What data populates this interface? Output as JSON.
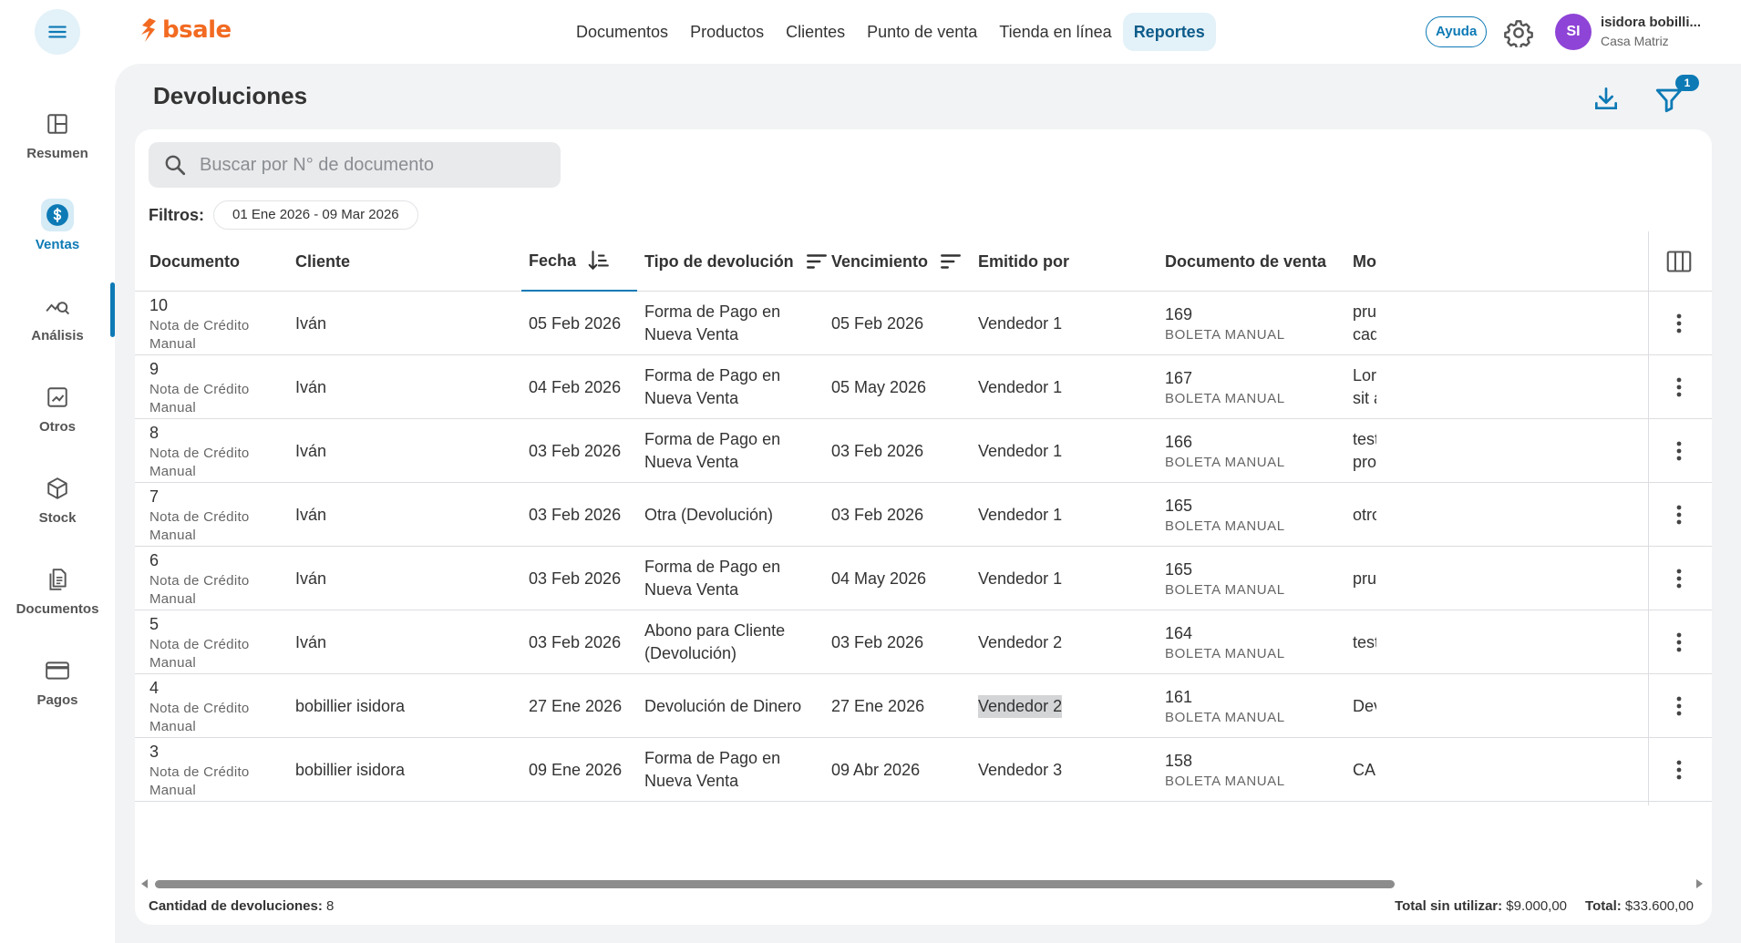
{
  "header": {
    "logo_text": "bsale",
    "nav": [
      "Documentos",
      "Productos",
      "Clientes",
      "Punto de venta",
      "Tienda en línea",
      "Reportes"
    ],
    "active_nav": "Reportes",
    "help_label": "Ayuda",
    "user": {
      "initials": "SI",
      "name": "isidora bobilli...",
      "branch": "Casa Matriz",
      "avatar_color": "#8e44d6"
    }
  },
  "sidebar": {
    "items": [
      {
        "label": "Resumen",
        "icon": "layout-icon"
      },
      {
        "label": "Ventas",
        "icon": "dollar-icon",
        "active": true
      },
      {
        "label": "Análisis",
        "icon": "analytics-icon"
      },
      {
        "label": "Otros",
        "icon": "chart-icon"
      },
      {
        "label": "Stock",
        "icon": "box-icon"
      },
      {
        "label": "Documentos",
        "icon": "documents-icon"
      },
      {
        "label": "Pagos",
        "icon": "card-icon"
      }
    ]
  },
  "page": {
    "title": "Devoluciones",
    "filter_badge": "1",
    "search_placeholder": "Buscar por N° de documento",
    "filters_label": "Filtros:",
    "filter_chip": "01 Ene 2026 - 09 Mar 2026"
  },
  "table": {
    "columns": [
      "Documento",
      "Cliente",
      "Fecha",
      "Tipo de devolución",
      "Vencimiento",
      "Emitido por",
      "Documento de venta",
      "Mot"
    ],
    "rows": [
      {
        "doc_num": "10",
        "doc_type": "Nota de Crédito Manual",
        "cliente": "Iván",
        "fecha": "05 Feb 2026",
        "tipo": "Forma de Pago en Nueva Venta",
        "vencimiento": "05 Feb 2026",
        "emitido": "Vendedor 1",
        "venta_num": "169",
        "venta_type": "BOLETA MANUAL",
        "motivo_1": "pruє",
        "motivo_2": "cadε"
      },
      {
        "doc_num": "9",
        "doc_type": "Nota de Crédito Manual",
        "cliente": "Iván",
        "fecha": "04 Feb 2026",
        "tipo": "Forma de Pago en Nueva Venta",
        "vencimiento": "05 May 2026",
        "emitido": "Vendedor 1",
        "venta_num": "167",
        "venta_type": "BOLETA MANUAL",
        "motivo_1": "Lore",
        "motivo_2": "sit a"
      },
      {
        "doc_num": "8",
        "doc_type": "Nota de Crédito Manual",
        "cliente": "Iván",
        "fecha": "03 Feb 2026",
        "tipo": "Forma de Pago en Nueva Venta",
        "vencimiento": "03 Feb 2026",
        "emitido": "Vendedor 1",
        "venta_num": "166",
        "venta_type": "BOLETA MANUAL",
        "motivo_1": "test",
        "motivo_2": "proc"
      },
      {
        "doc_num": "7",
        "doc_type": "Nota de Crédito Manual",
        "cliente": "Iván",
        "fecha": "03 Feb 2026",
        "tipo": "Otra (Devolución)",
        "vencimiento": "03 Feb 2026",
        "emitido": "Vendedor 1",
        "venta_num": "165",
        "venta_type": "BOLETA MANUAL",
        "motivo_1": "otro",
        "motivo_2": ""
      },
      {
        "doc_num": "6",
        "doc_type": "Nota de Crédito Manual",
        "cliente": "Iván",
        "fecha": "03 Feb 2026",
        "tipo": "Forma de Pago en Nueva Venta",
        "vencimiento": "04 May 2026",
        "emitido": "Vendedor 1",
        "venta_num": "165",
        "venta_type": "BOLETA MANUAL",
        "motivo_1": "prue",
        "motivo_2": ""
      },
      {
        "doc_num": "5",
        "doc_type": "Nota de Crédito Manual",
        "cliente": "Iván",
        "fecha": "03 Feb 2026",
        "tipo": "Abono para Cliente (Devolución)",
        "vencimiento": "03 Feb 2026",
        "emitido": "Vendedor 2",
        "venta_num": "164",
        "venta_type": "BOLETA MANUAL",
        "motivo_1": "test",
        "motivo_2": ""
      },
      {
        "doc_num": "4",
        "doc_type": "Nota de Crédito Manual",
        "cliente": "bobillier isidora",
        "fecha": "27 Ene 2026",
        "tipo": "Devolución de Dinero",
        "vencimiento": "27 Ene 2026",
        "emitido": "Vendedor 2",
        "venta_num": "161",
        "venta_type": "BOLETA MANUAL",
        "motivo_1": "Dev",
        "motivo_2": "",
        "highlight_emitido": true
      },
      {
        "doc_num": "3",
        "doc_type": "Nota de Crédito Manual",
        "cliente": "bobillier isidora",
        "fecha": "09 Ene 2026",
        "tipo": "Forma de Pago en Nueva Venta",
        "vencimiento": "09 Abr 2026",
        "emitido": "Vendedor 3",
        "venta_num": "158",
        "venta_type": "BOLETA MANUAL",
        "motivo_1": "CAM",
        "motivo_2": ""
      }
    ]
  },
  "footer": {
    "count_label": "Cantidad de devoluciones:",
    "count_value": "8",
    "unused_label": "Total sin utilizar:",
    "unused_value": "$9.000,00",
    "total_label": "Total:",
    "total_value": "$33.600,00"
  }
}
